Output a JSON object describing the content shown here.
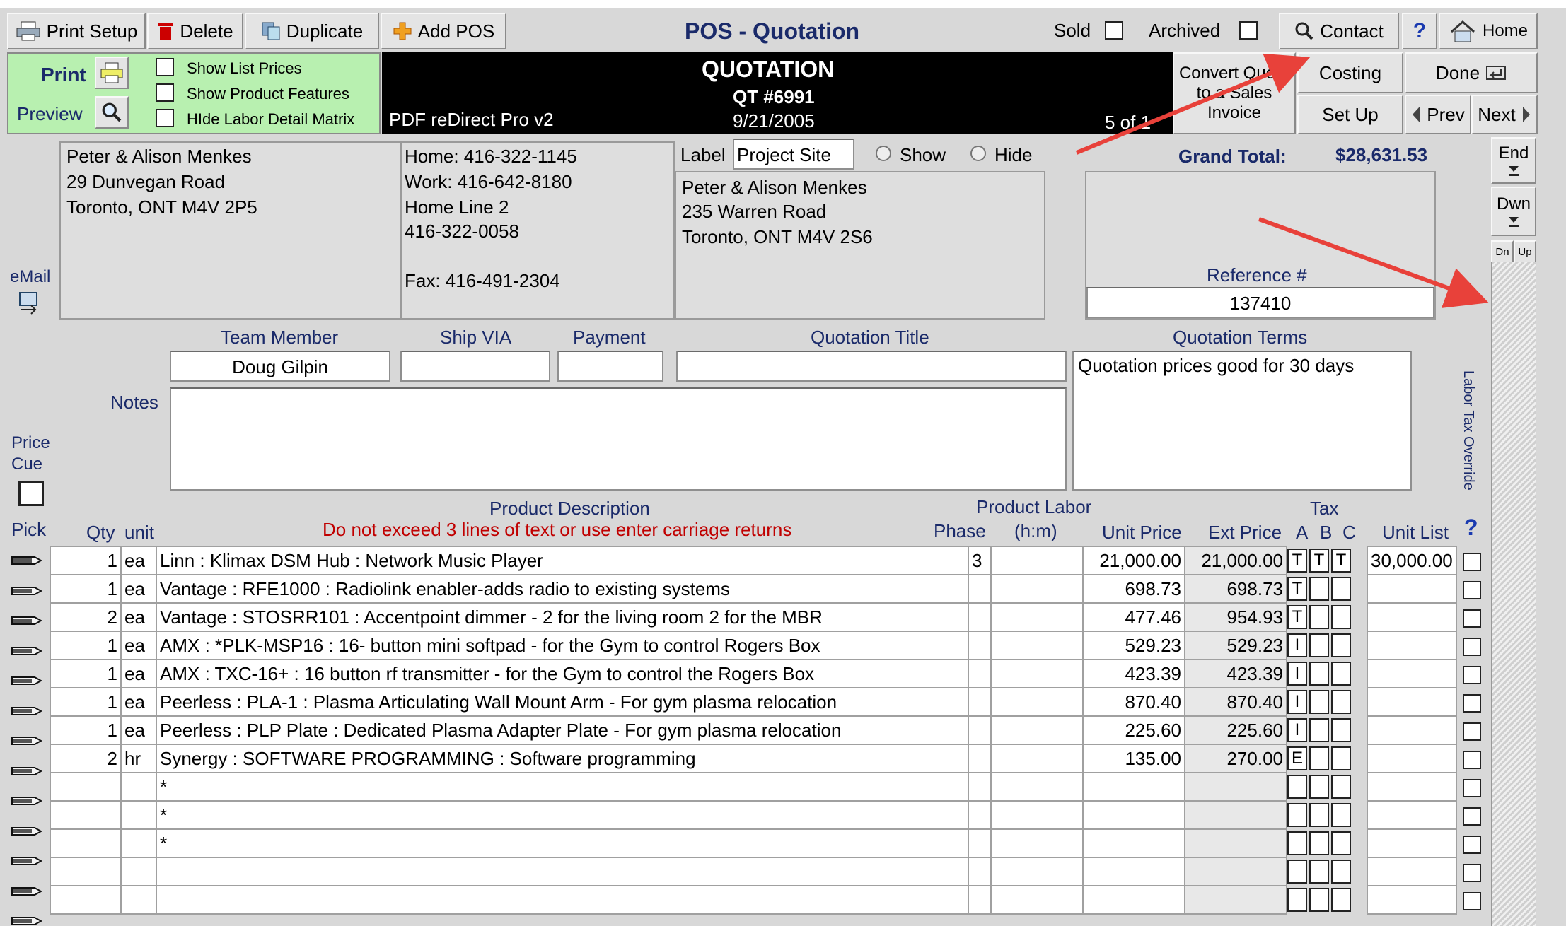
{
  "toolbar": {
    "print_setup": "Print Setup",
    "delete": "Delete",
    "duplicate": "Duplicate",
    "add_pos": "Add POS",
    "title": "POS - Quotation",
    "sold": "Sold",
    "archived": "Archived",
    "contact": "Contact",
    "help": "?",
    "home": "Home"
  },
  "print_panel": {
    "print": "Print",
    "preview": "Preview",
    "options": [
      "Show List Prices",
      "Show Product Features",
      "HIde Labor Detail Matrix"
    ]
  },
  "banner": {
    "heading": "QUOTATION",
    "number": "QT #6991",
    "date": "9/21/2005",
    "printer": "PDF reDirect Pro v2",
    "record_pos": "5 of 1"
  },
  "actions": {
    "convert": "Convert Quote to a Sales Invoice",
    "costing": "Costing",
    "done": "Done",
    "setup": "Set Up",
    "prev": "Prev",
    "next": "Next",
    "end": "End",
    "dwn": "Dwn",
    "dn": "Dn",
    "up": "Up"
  },
  "customer": {
    "email_label": "eMail",
    "name": "Peter & Alison Menkes",
    "address1": "29 Dunvegan Road",
    "address2": "Toronto, ONT M4V 2P5",
    "home": "Home: 416-322-1145",
    "work": "Work: 416-642-8180",
    "home_line2_label": "Home Line 2",
    "home_line2": " 416-322-0058",
    "fax": "Fax: 416-491-2304"
  },
  "ship_to": {
    "label_caption": "Label",
    "label_value": "Project Site",
    "show": "Show",
    "hide": "Hide",
    "name": "Peter & Alison Menkes",
    "address1": "235 Warren Road",
    "address2": "Toronto, ONT M4V 2S6"
  },
  "totals": {
    "grand_total_label": "Grand Total:",
    "grand_total": "$28,631.53",
    "reference_label": "Reference #",
    "reference": "137410"
  },
  "form": {
    "team_member_label": "Team Member",
    "team_member": "Doug Gilpin",
    "ship_via_label": "Ship VIA",
    "payment_label": "Payment",
    "title_label": "Quotation Title",
    "terms_label": "Quotation Terms",
    "terms": "Quotation prices good for 30 days",
    "notes_label": "Notes",
    "price_cue": "Price Cue",
    "labor_tax_override": "Labor Tax Override"
  },
  "columns": {
    "pick": "Pick",
    "qty": "Qty",
    "unit": "unit",
    "desc": "Product Description",
    "desc_warning": "Do not exceed 3 lines of text or use enter carriage returns",
    "product_labor": "Product Labor",
    "phase": "Phase",
    "hm": "(h:m)",
    "unit_price": "Unit Price",
    "ext_price": "Ext Price",
    "tax": "Tax",
    "tax_a": "A",
    "tax_b": "B",
    "tax_c": "C",
    "unit_list": "Unit List",
    "q": "?"
  },
  "rows": [
    {
      "qty": "1",
      "unit": "ea",
      "desc": "Linn : Klimax DSM Hub : Network Music Player",
      "phase": "3",
      "hm": "",
      "price": "21,000.00",
      "ext": "21,000.00",
      "a": "T",
      "b": "T",
      "c": "T",
      "list": "30,000.00"
    },
    {
      "qty": "1",
      "unit": "ea",
      "desc": "Vantage : RFE1000 : Radiolink enabler-adds radio to existing systems",
      "phase": "",
      "hm": "",
      "price": "698.73",
      "ext": "698.73",
      "a": "T",
      "b": "",
      "c": "",
      "list": ""
    },
    {
      "qty": "2",
      "unit": "ea",
      "desc": "Vantage : STOSRR101 : Accentpoint dimmer - 2 for the living room 2 for the MBR",
      "phase": "",
      "hm": "",
      "price": "477.46",
      "ext": "954.93",
      "a": "T",
      "b": "",
      "c": "",
      "list": ""
    },
    {
      "qty": "1",
      "unit": "ea",
      "desc": "AMX : *PLK-MSP16 : 16- button mini softpad - for the Gym to control Rogers Box",
      "phase": "",
      "hm": "",
      "price": "529.23",
      "ext": "529.23",
      "a": "I",
      "b": "",
      "c": "",
      "list": ""
    },
    {
      "qty": "1",
      "unit": "ea",
      "desc": "AMX : TXC-16+ : 16 button rf transmitter - for the Gym to control the Rogers Box",
      "phase": "",
      "hm": "",
      "price": "423.39",
      "ext": "423.39",
      "a": "I",
      "b": "",
      "c": "",
      "list": ""
    },
    {
      "qty": "1",
      "unit": "ea",
      "desc": "Peerless : PLA-1 : Plasma Articulating Wall Mount Arm - For gym plasma relocation",
      "phase": "",
      "hm": "",
      "price": "870.40",
      "ext": "870.40",
      "a": "I",
      "b": "",
      "c": "",
      "list": ""
    },
    {
      "qty": "1",
      "unit": "ea",
      "desc": "Peerless : PLP Plate : Dedicated Plasma Adapter Plate - For gym plasma relocation",
      "phase": "",
      "hm": "",
      "price": "225.60",
      "ext": "225.60",
      "a": "I",
      "b": "",
      "c": "",
      "list": ""
    },
    {
      "qty": "2",
      "unit": "hr",
      "desc": "Synergy : SOFTWARE PROGRAMMING : Software programming",
      "phase": "",
      "hm": "",
      "price": "135.00",
      "ext": "270.00",
      "a": "E",
      "b": "",
      "c": "",
      "list": ""
    },
    {
      "qty": "",
      "unit": "",
      "desc": "*",
      "phase": "",
      "hm": "",
      "price": "",
      "ext": "",
      "a": "",
      "b": "",
      "c": "",
      "list": ""
    },
    {
      "qty": "",
      "unit": "",
      "desc": "*",
      "phase": "",
      "hm": "",
      "price": "",
      "ext": "",
      "a": "",
      "b": "",
      "c": "",
      "list": ""
    },
    {
      "qty": "",
      "unit": "",
      "desc": "*",
      "phase": "",
      "hm": "",
      "price": "",
      "ext": "",
      "a": "",
      "b": "",
      "c": "",
      "list": ""
    },
    {
      "qty": "",
      "unit": "",
      "desc": "",
      "phase": "",
      "hm": "",
      "price": "",
      "ext": "",
      "a": "",
      "b": "",
      "c": "",
      "list": ""
    },
    {
      "qty": "",
      "unit": "",
      "desc": "",
      "phase": "",
      "hm": "",
      "price": "",
      "ext": "",
      "a": "",
      "b": "",
      "c": "",
      "list": ""
    }
  ],
  "colors": {
    "banner_bg": "#000000",
    "print_panel_bg": "#b8f0b0",
    "warning_text": "#c00000",
    "arrow": "#e8413a"
  }
}
